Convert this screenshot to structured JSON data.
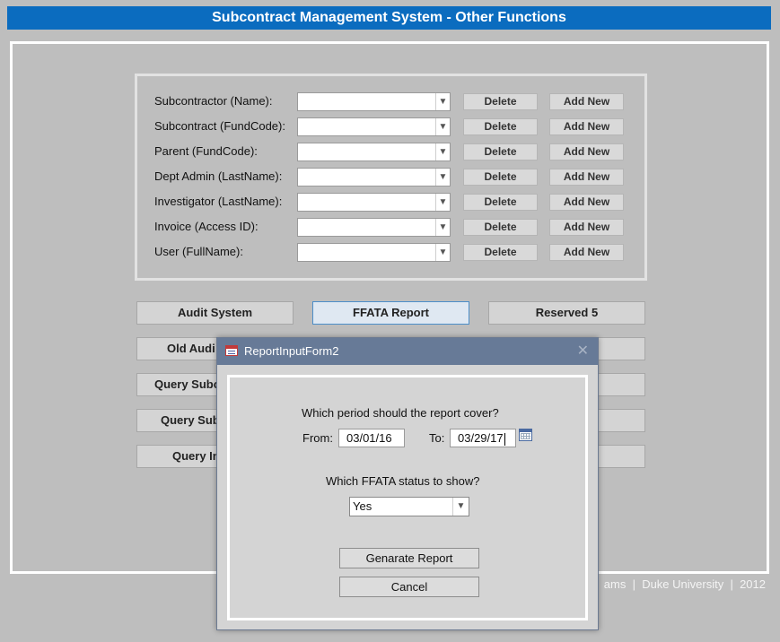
{
  "app": {
    "title": "Subcontract Management System - Other Functions"
  },
  "lookup_rows": [
    {
      "label": "Subcontractor (Name):",
      "delete_label": "Delete",
      "add_label": "Add New"
    },
    {
      "label": "Subcontract (FundCode):",
      "delete_label": "Delete",
      "add_label": "Add New"
    },
    {
      "label": "Parent (FundCode):",
      "delete_label": "Delete",
      "add_label": "Add New"
    },
    {
      "label": "Dept Admin (LastName):",
      "delete_label": "Delete",
      "add_label": "Add New"
    },
    {
      "label": "Investigator (LastName):",
      "delete_label": "Delete",
      "add_label": "Add New"
    },
    {
      "label": "Invoice (Access ID):",
      "delete_label": "Delete",
      "add_label": "Add New"
    },
    {
      "label": "User (FullName):",
      "delete_label": "Delete",
      "add_label": "Add New"
    }
  ],
  "function_buttons": {
    "audit_system": "Audit System",
    "ffata_report": "FFATA Report",
    "reserved_5": "Reserved 5",
    "old_audit": "Old Audi",
    "query_subc_1": "Query Subc",
    "query_sub_2": "Query Sub",
    "query_in": "Query In"
  },
  "footer": {
    "org_fragment": "ams",
    "university": "Duke University",
    "year": "2012",
    "separator": "|"
  },
  "dialog": {
    "title": "ReportInputForm2",
    "close_glyph": "✕",
    "period_question": "Which period should the report cover?",
    "from_label": "From:",
    "from_value": "03/01/16",
    "to_label": "To:",
    "to_value": "03/29/17",
    "status_question": "Which FFATA status to show?",
    "status_value": "Yes",
    "generate_label": "Genarate Report",
    "cancel_label": "Cancel"
  },
  "icons": {
    "dropdown": "chevron-down-icon",
    "form": "form-icon",
    "calendar": "calendar-icon",
    "close": "close-icon"
  },
  "colors": {
    "title_bar": "#0b6cbf",
    "background": "#bebebe",
    "dialog_title_bar": "#677a97",
    "active_button_border": "#4c8ec9"
  }
}
